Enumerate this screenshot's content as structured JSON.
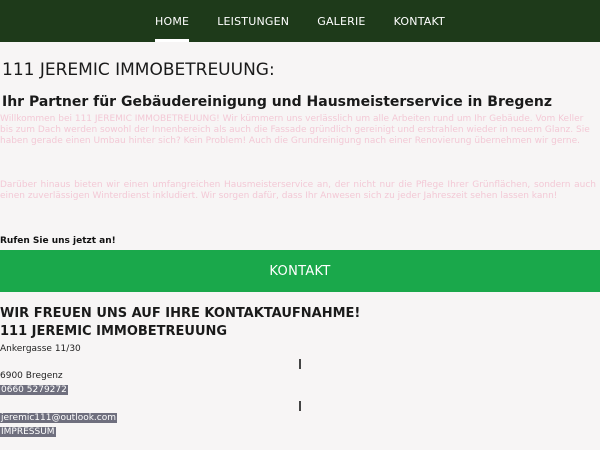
{
  "nav": {
    "items": [
      {
        "label": "HOME",
        "active": true
      },
      {
        "label": "LEISTUNGEN",
        "active": false
      },
      {
        "label": "GALERIE",
        "active": false
      },
      {
        "label": "KONTAKT",
        "active": false
      }
    ]
  },
  "main": {
    "title": "111 JEREMIC IMMOBETREUUNG:",
    "subtitle": "Ihr Partner für Gebäudereinigung und Hausmeisterservice in Bregenz",
    "intro": "Willkommen bei 111 JEREMIC IMMOBETREUUNG! Wir kümmern uns verlässlich um alle Arbeiten rund um Ihr Gebäude. Vom Keller bis zum Dach werden sowohl der Innenbereich als auch die Fassade gründlich gereinigt und erstrahlen wieder in neuem Glanz. Sie haben gerade einen Umbau hinter sich? Kein Problem! Auch die Grundreinigung nach einer Renovierung übernehmen wir gerne.",
    "intro2": "Darüber hinaus bieten wir einen umfangreichen Hausmeisterservice an, der nicht nur die Pflege Ihrer Grünflächen, sondern auch einen zuverlässigen Winterdienst inkludiert. Wir sorgen dafür, dass Ihr Anwesen sich zu jeder Jahreszeit sehen lassen kann!",
    "call": "Rufen Sie uns jetzt an!"
  },
  "cta": {
    "label": "KONTAKT"
  },
  "contact": {
    "welcome": "WIR FREUEN UNS AUF IHRE KONTAKTAUFNAHME!",
    "company": "111 JEREMIC IMMOBETREUUNG",
    "street": "Ankergasse 11/30",
    "city": "6900 Bregenz",
    "phone": "0660 5279272",
    "email": "jeremic111@outlook.com",
    "imprint": "IMPRESSUM"
  },
  "colors": {
    "nav_bg": "#1e3a1a",
    "cta_bg": "#1aa84b",
    "highlight": "#6f6f7e"
  }
}
